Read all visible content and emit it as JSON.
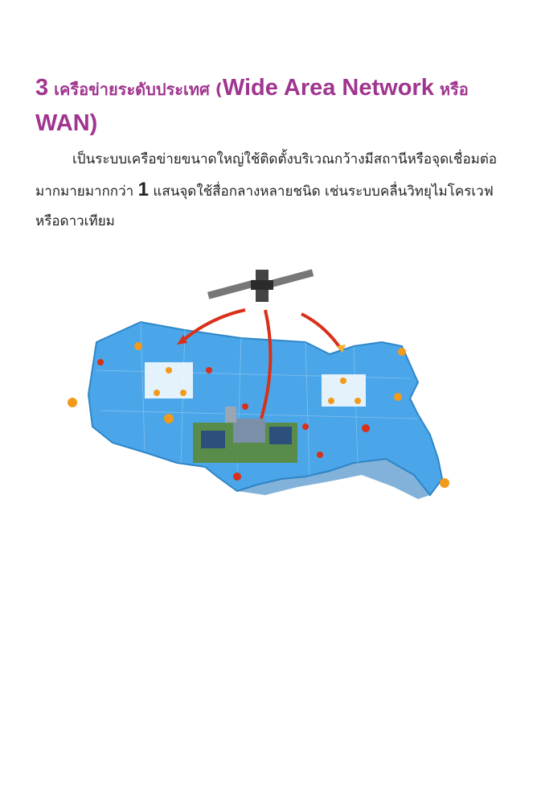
{
  "heading": {
    "number": "3",
    "thai_title": "เครือข่ายระดับประเทศ",
    "paren_open": "(",
    "english_title": "Wide Area Network",
    "or_word": "หรือ",
    "abbr": "WAN)"
  },
  "paragraph": {
    "part1": "เป็นระบบเครือข่ายขนาดใหญ่ใช้ติดตั้งบริเวณกว้างมีสถานีหรือจุดเชื่อมต่อมากมายมากกว่า",
    "number": "1",
    "part2": "แสนจุดใช้สื่อกลางหลายชนิด เช่นระบบคลื่นวิทยุไมโครเวฟหรือดาวเทียม"
  },
  "figure": {
    "map_color": "#4aa6e8",
    "arrow_color": "#d8301a",
    "node_color": "#f29a1a"
  }
}
